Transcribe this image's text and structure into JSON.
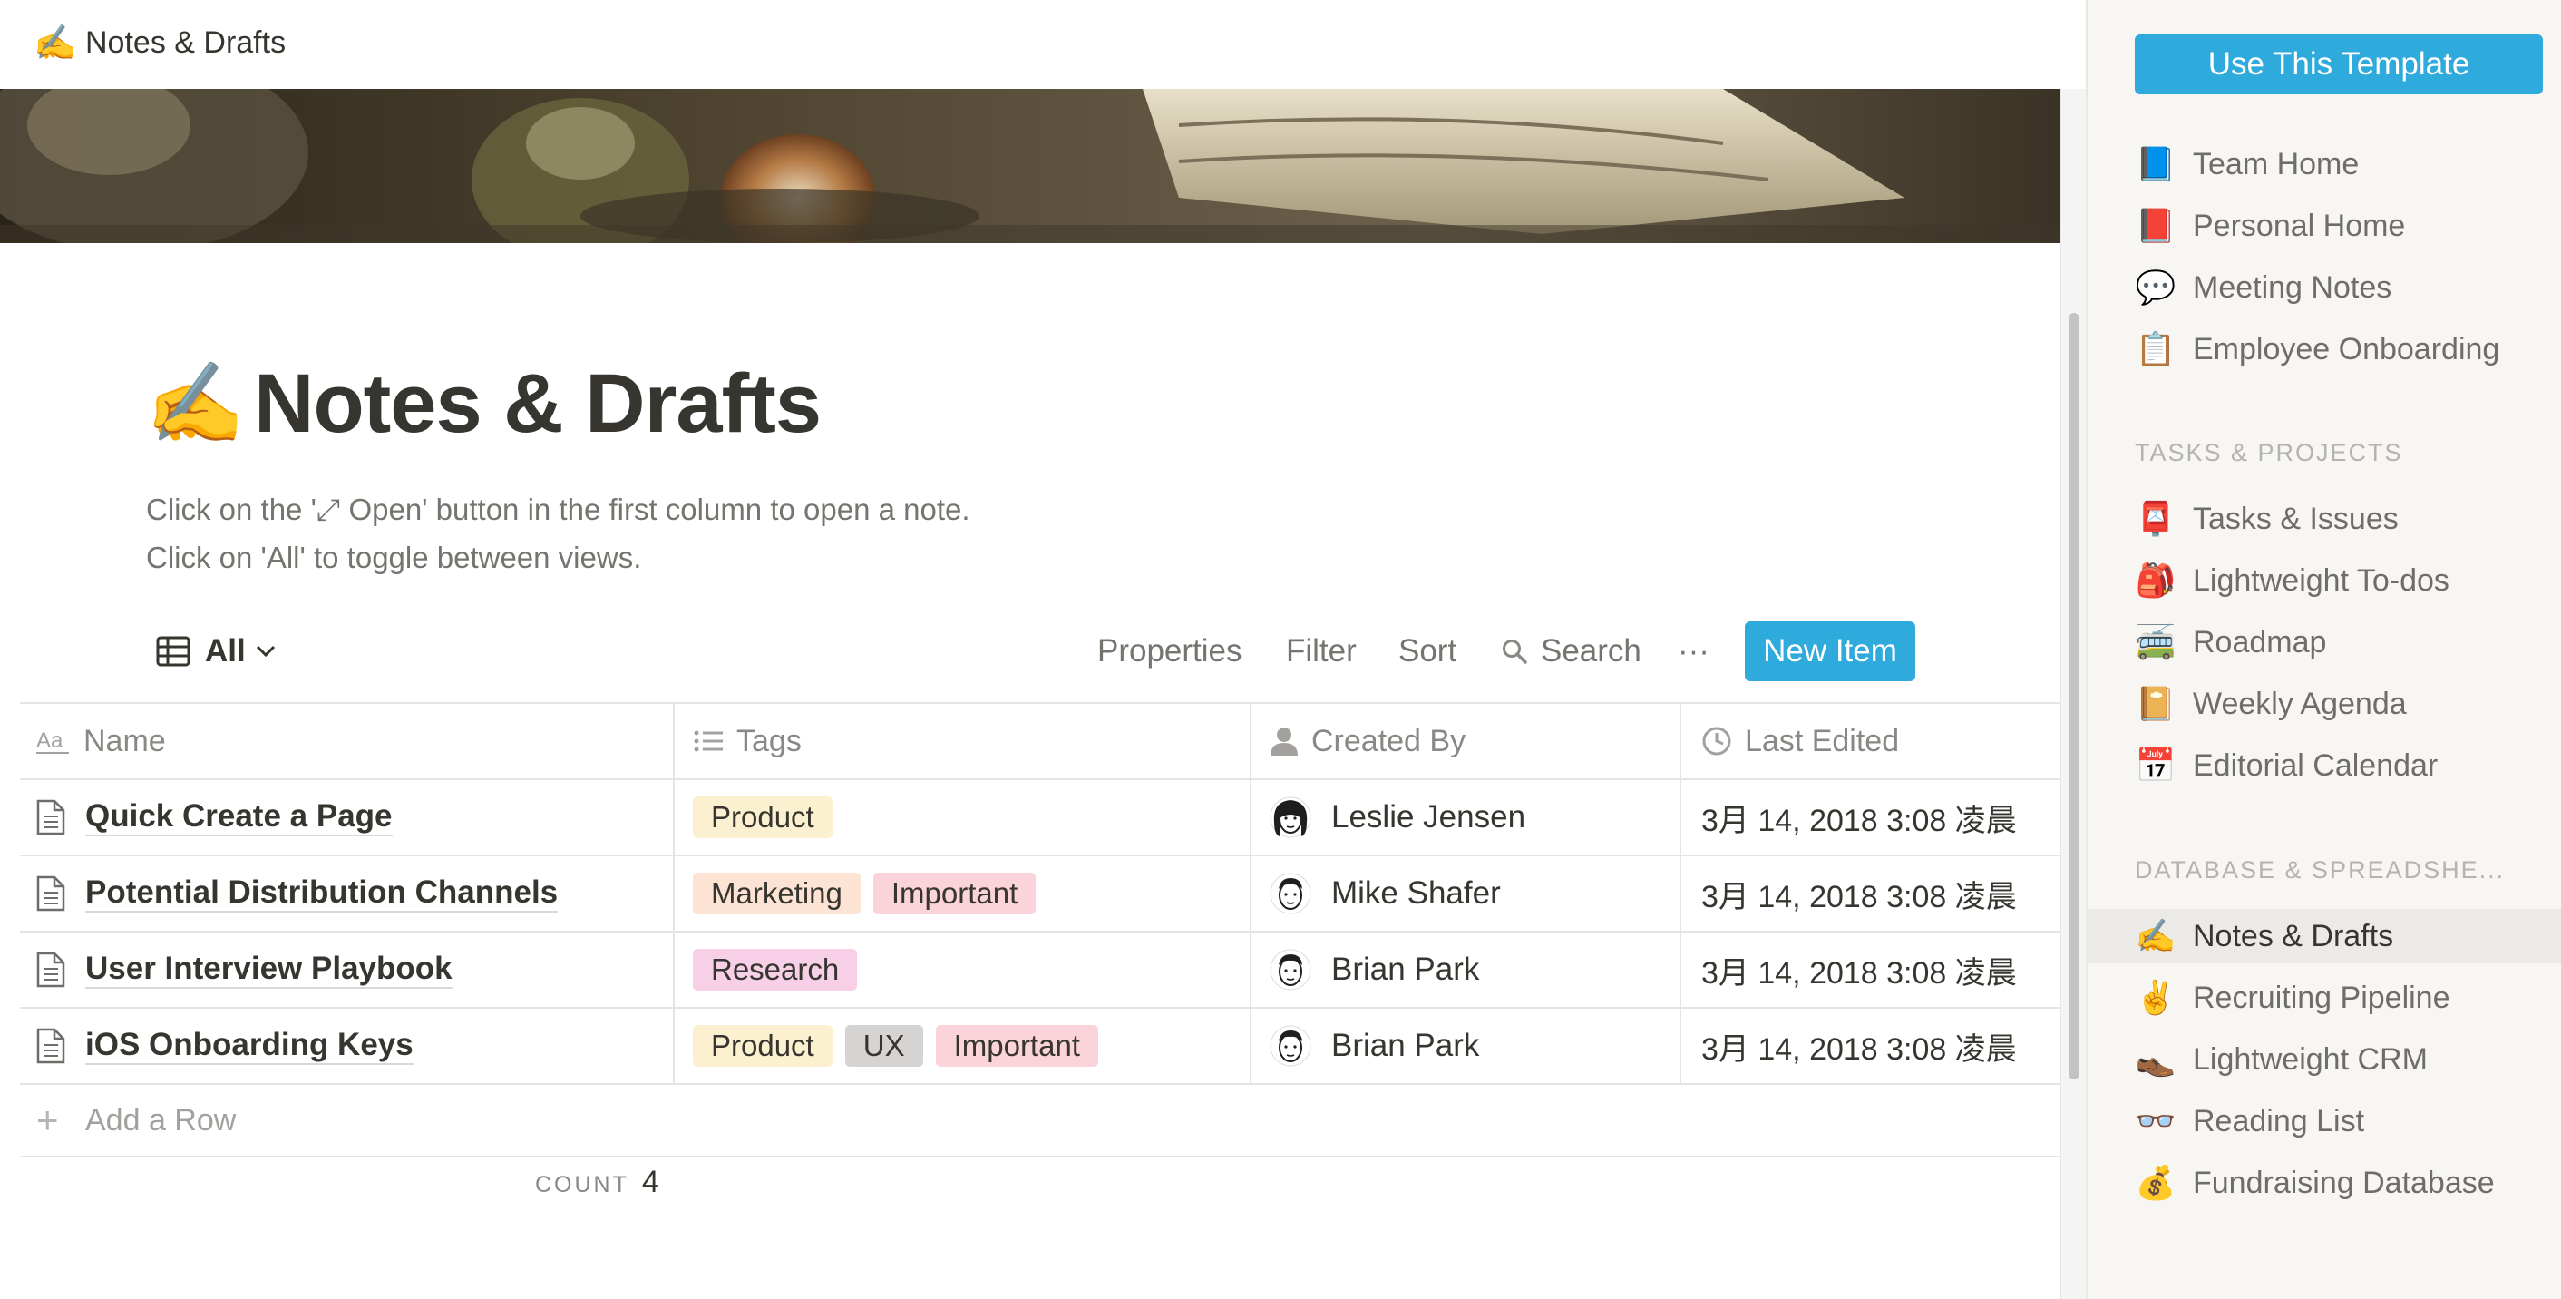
{
  "breadcrumb": {
    "emoji": "✍️",
    "label": "Notes & Drafts"
  },
  "page": {
    "emoji": "✍️",
    "title": "Notes & Drafts",
    "description": [
      "Click on the '⤢ Open' button in the first column to open a note.",
      "Click on 'All' to toggle between views."
    ]
  },
  "toolbar": {
    "view_label": "All",
    "properties": "Properties",
    "filter": "Filter",
    "sort": "Sort",
    "search": "Search",
    "more": "···",
    "new_item": "New Item"
  },
  "table": {
    "columns": {
      "name": "Name",
      "tags": "Tags",
      "created_by": "Created By",
      "last_edited": "Last Edited"
    },
    "rows": [
      {
        "name": "Quick Create a Page",
        "tags": [
          "Product"
        ],
        "created_by": "Leslie Jensen",
        "last_edited": "3月 14, 2018 3:08 凌晨"
      },
      {
        "name": "Potential Distribution Channels",
        "tags": [
          "Marketing",
          "Important"
        ],
        "created_by": "Mike Shafer",
        "last_edited": "3月 14, 2018 3:08 凌晨"
      },
      {
        "name": "User Interview Playbook",
        "tags": [
          "Research"
        ],
        "created_by": "Brian Park",
        "last_edited": "3月 14, 2018 3:08 凌晨"
      },
      {
        "name": "iOS Onboarding Keys",
        "tags": [
          "Product",
          "UX",
          "Important"
        ],
        "created_by": "Brian Park",
        "last_edited": "3月 14, 2018 3:08 凌晨"
      }
    ],
    "add_row": "Add a Row",
    "count_label": "COUNT",
    "count_value": "4"
  },
  "tag_colors": {
    "Product": "#fbf0cf",
    "Marketing": "#fde3d3",
    "Important": "#fbd3da",
    "Research": "#f7cfe6",
    "UX": "#d5d4d2"
  },
  "sidebar": {
    "cta": "Use This Template",
    "top_items": [
      {
        "emoji": "📘",
        "label": "Team Home"
      },
      {
        "emoji": "📕",
        "label": "Personal Home"
      },
      {
        "emoji": "💬",
        "label": "Meeting Notes"
      },
      {
        "emoji": "📋",
        "label": "Employee Onboarding"
      }
    ],
    "section_tasks": "TASKS & PROJECTS",
    "task_items": [
      {
        "emoji": "📮",
        "label": "Tasks & Issues"
      },
      {
        "emoji": "🎒",
        "label": "Lightweight To-dos"
      },
      {
        "emoji": "🚎",
        "label": "Roadmap"
      },
      {
        "emoji": "📔",
        "label": "Weekly Agenda"
      },
      {
        "emoji": "📅",
        "label": "Editorial Calendar"
      }
    ],
    "section_db": "DATABASE & SPREADSHE...",
    "db_items": [
      {
        "emoji": "✍️",
        "label": "Notes & Drafts",
        "active": true
      },
      {
        "emoji": "✌️",
        "label": "Recruiting Pipeline"
      },
      {
        "emoji": "👞",
        "label": "Lightweight CRM"
      },
      {
        "emoji": "👓",
        "label": "Reading List"
      },
      {
        "emoji": "💰",
        "label": "Fundraising Database"
      }
    ]
  },
  "colors": {
    "accent": "#2eaadc",
    "text": "#37352f",
    "muted": "#76746f",
    "sidebar_bg": "#f7f6f3"
  }
}
